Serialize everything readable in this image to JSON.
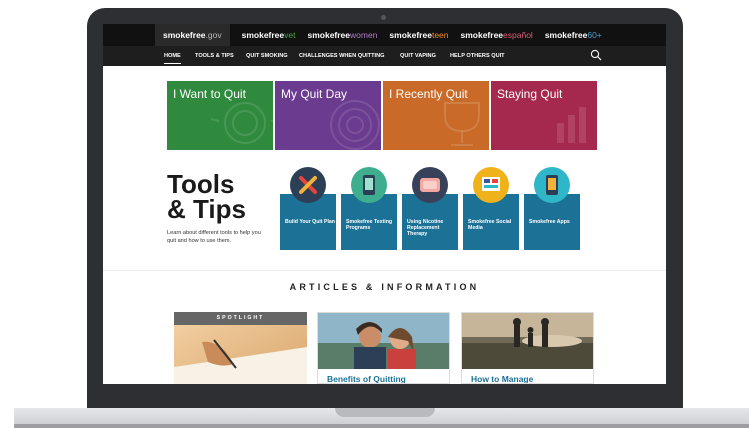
{
  "brand_bar": {
    "items": [
      {
        "main": "smokefree",
        "suffix": ".gov",
        "suffix_color": "#b9b9b9"
      },
      {
        "main": "smokefree",
        "suffix": "vet",
        "suffix_color": "#4aa93f"
      },
      {
        "main": "smokefree",
        "suffix": "women",
        "suffix_color": "#b07cc6"
      },
      {
        "main": "smokefree",
        "suffix": "teen",
        "suffix_color": "#f08a24"
      },
      {
        "main": "smokefree",
        "suffix": "español",
        "suffix_color": "#e05a7a"
      },
      {
        "main": "smokefree",
        "suffix": "60+",
        "suffix_color": "#4fa3d9"
      }
    ]
  },
  "nav": {
    "items": [
      "HOME",
      "TOOLS & TIPS",
      "QUIT SMOKING",
      "CHALLENGES WHEN QUITTING",
      "QUIT VAPING",
      "HELP OTHERS QUIT"
    ],
    "active_index": 0,
    "search_icon": "search-icon"
  },
  "banner_cards": [
    {
      "label": "I Want to Quit",
      "color": "#2f8a3e"
    },
    {
      "label": "My Quit Day",
      "color": "#6b3b8f"
    },
    {
      "label": "I Recently Quit",
      "color": "#c96a28"
    },
    {
      "label": "Staying Quit",
      "color": "#a5284e"
    }
  ],
  "tools": {
    "title_line1": "Tools",
    "title_line2": "& Tips",
    "subtitle": "Learn about different tools to help you quit and how to use them.",
    "items": [
      {
        "label": "Build Your Quit Plan",
        "icon": "x-plan-icon",
        "icon_bg": "#2d3e57"
      },
      {
        "label": "Smokefree Texting Programs",
        "icon": "phone-icon",
        "icon_bg": "#3fae8f"
      },
      {
        "label": "Using Nicotine Replacement Therapy",
        "icon": "patch-icon",
        "icon_bg": "#38415a"
      },
      {
        "label": "Smokefree Social Media",
        "icon": "social-media-icon",
        "icon_bg": "#f0b21a"
      },
      {
        "label": "Smokefree Apps",
        "icon": "app-icon",
        "icon_bg": "#2fb6c8"
      }
    ]
  },
  "articles": {
    "heading": "ARTICLES & INFORMATION",
    "cards": [
      {
        "badge": "SPOTLIGHT",
        "title": ""
      },
      {
        "badge": "",
        "title": "Benefits of Quitting"
      },
      {
        "badge": "",
        "title": "How to Manage"
      }
    ]
  },
  "colors": {
    "tool_card_bg": "#1c7296",
    "brand_bar_bg": "#111111",
    "nav_bg": "#1e1e1e"
  }
}
